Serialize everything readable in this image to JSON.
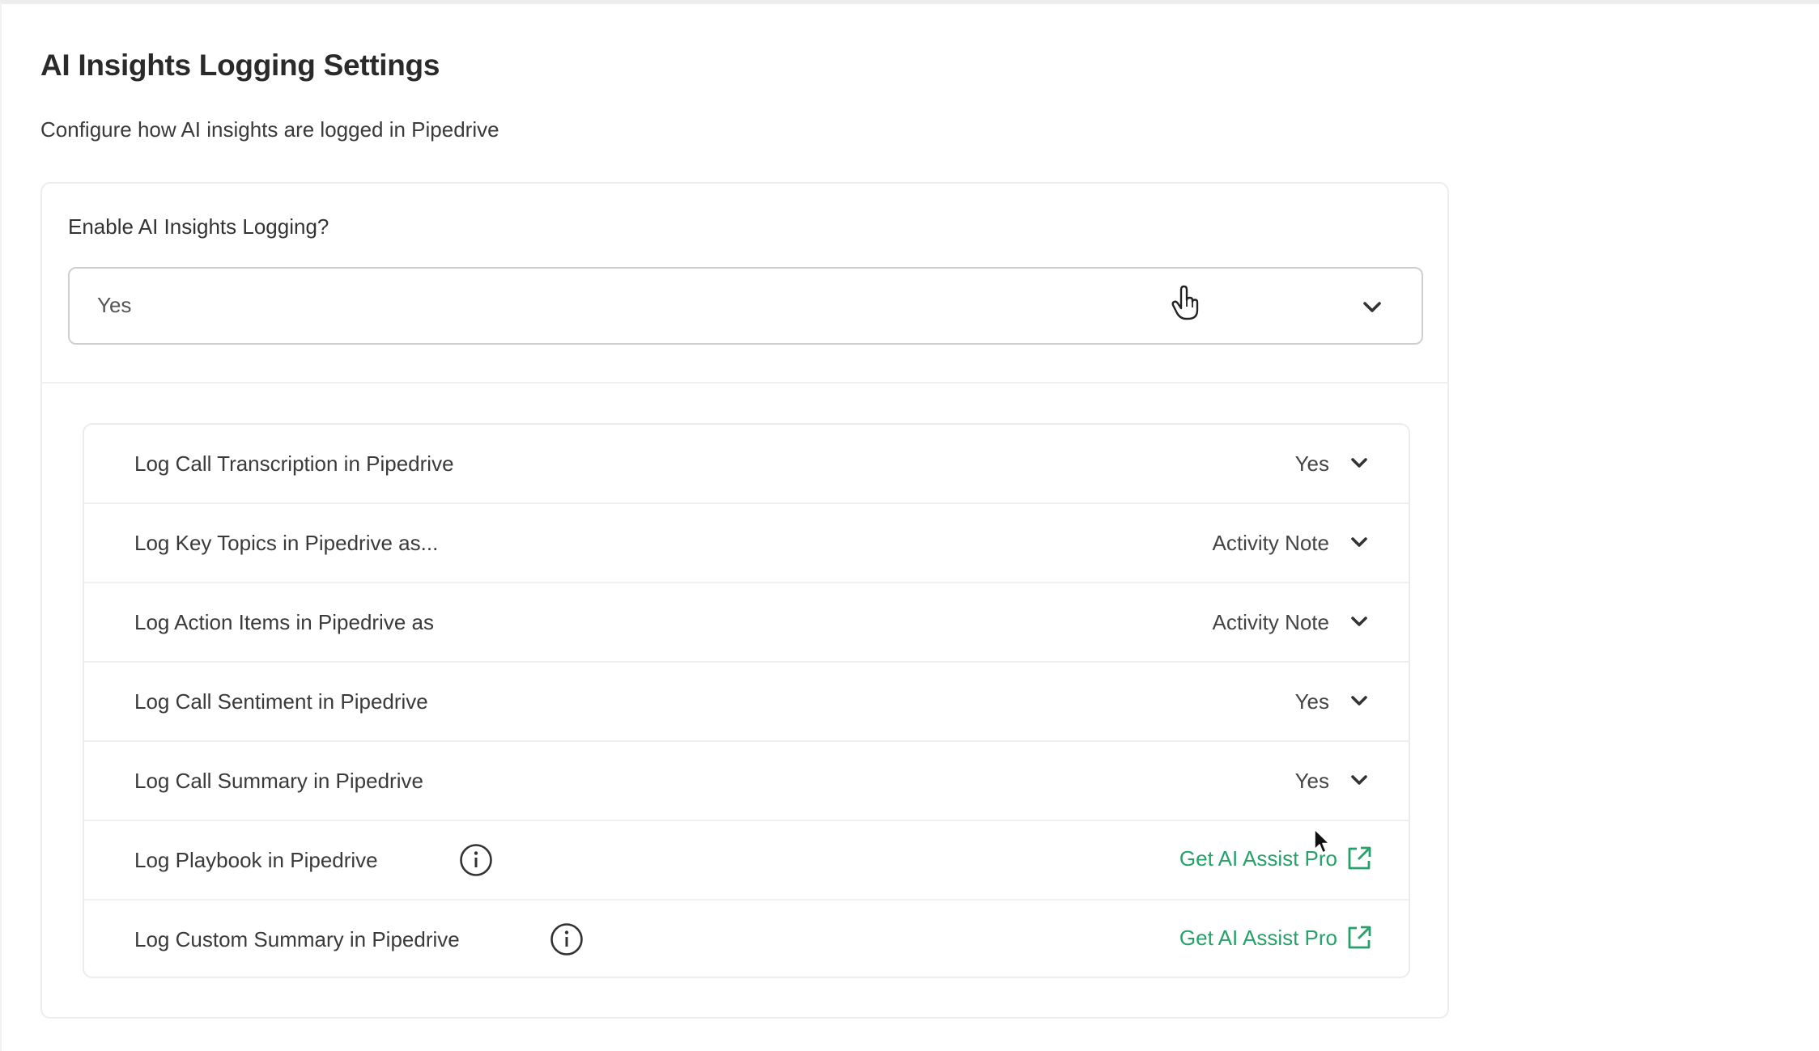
{
  "header": {
    "title": "AI Insights Logging Settings",
    "subtitle": "Configure how AI insights are logged in Pipedrive"
  },
  "enable": {
    "label": "Enable AI Insights Logging?",
    "selected": "Yes",
    "icon": "chevron-down-icon"
  },
  "rows": [
    {
      "label": "Log Call Transcription in Pipedrive",
      "value": "Yes"
    },
    {
      "label": "Log Key Topics in Pipedrive as...",
      "value": "Activity Note"
    },
    {
      "label": "Log Action Items in Pipedrive as",
      "value": "Activity Note"
    },
    {
      "label": "Log Call Sentiment in Pipedrive",
      "value": "Yes"
    },
    {
      "label": "Log Call Summary in Pipedrive",
      "value": "Yes"
    },
    {
      "label": "Log Playbook in Pipedrive",
      "link": "Get AI Assist Pro",
      "info_icon": "info-icon",
      "link_icon": "external-link-icon"
    },
    {
      "label": "Log Custom Summary in Pipedrive",
      "link": "Get AI Assist Pro",
      "info_icon": "info-icon",
      "link_icon": "external-link-icon"
    }
  ],
  "colors": {
    "link": "#27a06a",
    "text": "#3a3a3a",
    "border": "#ececec"
  }
}
